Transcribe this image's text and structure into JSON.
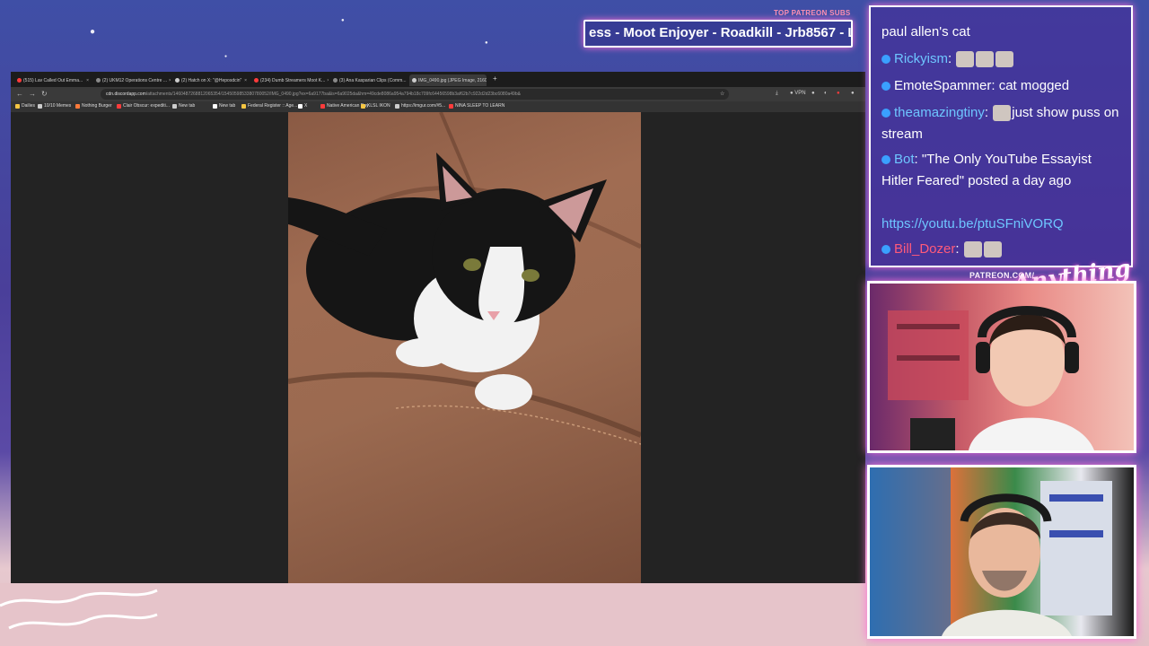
{
  "overlay": {
    "subs_title": "TOP PATREON SUBS",
    "subs_ticker": "ess - Moot Enjoyer - Roadkill - Jrb8567 - L",
    "patreon_label": "PATREON.COM/",
    "logo_text": "Anything Else?"
  },
  "browser": {
    "tabs": [
      {
        "label": "(515) Lav Called Out Emma...",
        "color": "#ff3b3b"
      },
      {
        "label": "(2) UKM12 Operations Centre ...",
        "color": "#8a8a8a"
      },
      {
        "label": "(2) Hatch on X: \"@Heposdcin\"",
        "color": "#cccccc"
      },
      {
        "label": "(234) Dumb Streamers Moot K...",
        "color": "#ff3b3b"
      },
      {
        "label": "(3) Ana Kasparian Clips (Comm...",
        "color": "#8a8a8a"
      },
      {
        "label": "IMG_0490.jpg (JPEG Image, 2160 ×",
        "color": "#cccccc",
        "active": true
      }
    ],
    "url_domain": "cdn.discordapp.com",
    "url_path": "/attachments/1460487268812065354/1545059853380780052/IMG_0490.jpg?ex=6a9177ba&is=6a9025da&hm=49cde8086a954a794b18c709fc64456598b3af62b7c922d2d23bc6080a49b&",
    "vpn_label": "VPN",
    "bookmarks": [
      {
        "label": "Dailies",
        "color": "#f5c542"
      },
      {
        "label": "10/10 Memes",
        "color": "#cccccc"
      },
      {
        "label": "Nothing Burger",
        "color": "#ff7a3a"
      },
      {
        "label": "Clair Obscur: expediti...",
        "color": "#ff3b3b"
      },
      {
        "label": "New tab",
        "color": "#cccccc"
      },
      {
        "label": "New tab",
        "color": "#ffffff"
      },
      {
        "label": "Federal Register :: Age...",
        "color": "#f5c542"
      },
      {
        "label": "X",
        "color": "#ffffff"
      },
      {
        "label": "Native American Day",
        "color": "#ff3b3b"
      },
      {
        "label": "KLSL IKON",
        "color": "#f5c542"
      },
      {
        "label": "https://imgur.com/#5...",
        "color": "#cccccc"
      },
      {
        "label": "NINA SLEEP TO LEARN",
        "color": "#ff3b3b"
      }
    ]
  },
  "chat": {
    "messages": [
      {
        "user": "",
        "text": "paul allen's cat",
        "user_color": "#ffffff",
        "emotes": 0
      },
      {
        "user": "Rickyism",
        "text": "",
        "user_color": "#6ec6ff",
        "emotes": 3
      },
      {
        "user": "EmoteSpammer",
        "text": "cat mogged",
        "user_color": "#ffffff",
        "emotes": 0
      },
      {
        "user": "theamazingtiny",
        "text": "just show puss on stream",
        "user_color": "#6ec6ff",
        "emotes": 1
      },
      {
        "user": "Bot",
        "text": "\"The Only YouTube Essayist Hitler Feared\" posted a day ago",
        "user_color": "#6ec6ff",
        "emotes": 0
      },
      {
        "user": "",
        "text": "https://youtu.be/ptuSFniVORQ",
        "user_color": "#6ec6ff",
        "emotes": 0,
        "is_link": true
      },
      {
        "user": "Bill_Dozer",
        "text": "",
        "user_color": "#ff5a7a",
        "emotes": 2
      }
    ]
  },
  "icons": {
    "back": "back-arrow-icon",
    "forward": "forward-arrow-icon",
    "reload": "reload-icon",
    "download": "download-icon",
    "star": "bookmark-star-icon"
  }
}
